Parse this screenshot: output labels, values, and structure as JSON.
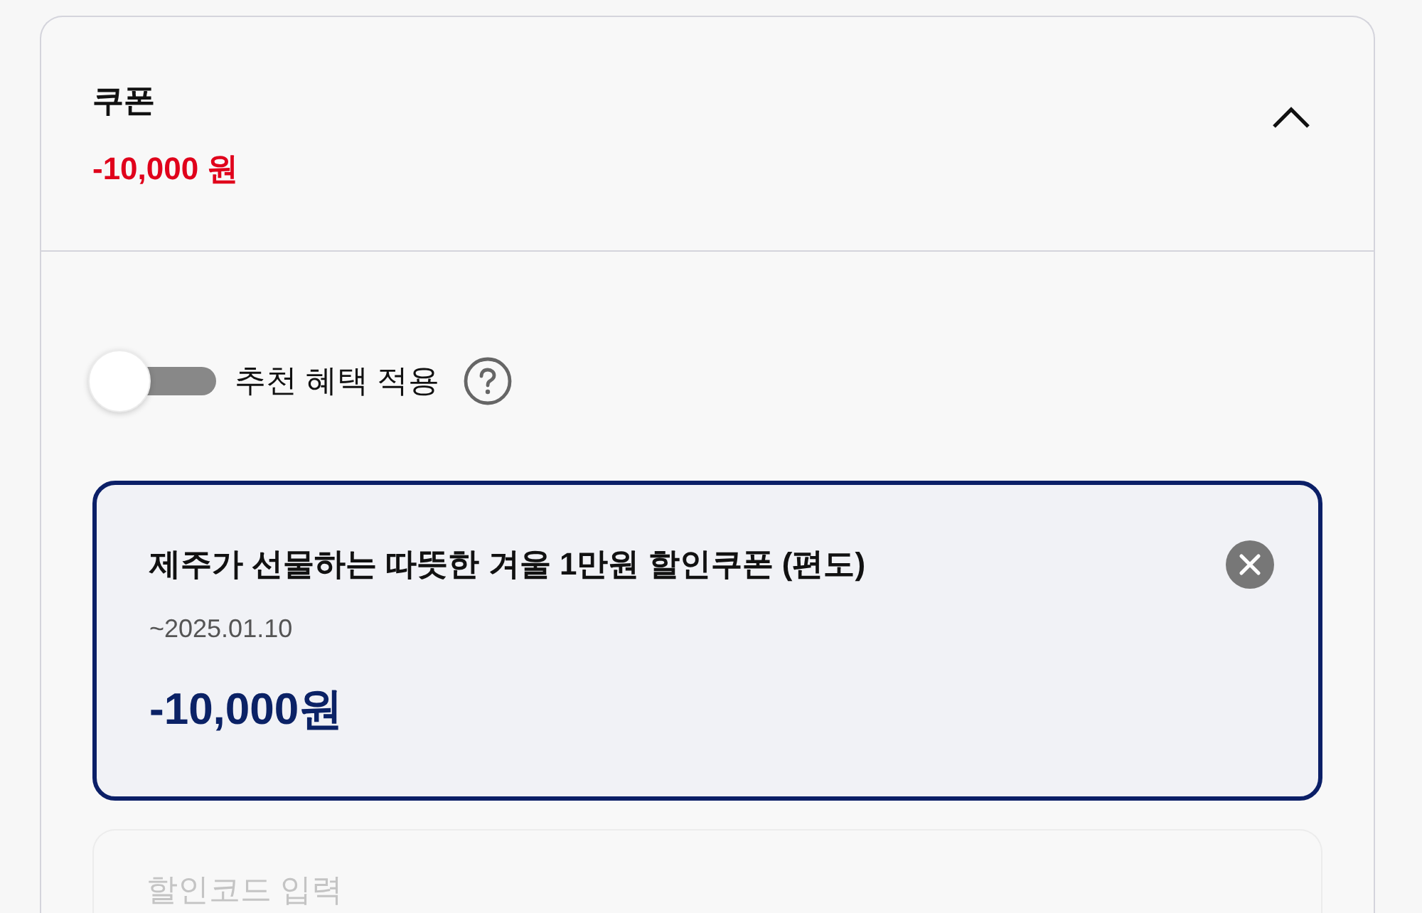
{
  "section": {
    "title": "쿠폰",
    "total": "-10,000 원",
    "expanded": true
  },
  "recommend_toggle": {
    "label": "추천 혜택 적용",
    "on": false
  },
  "applied_coupons": [
    {
      "name": "제주가 선물하는 따뜻한 겨울 1만원 할인쿠폰 (편도)",
      "expiry": "~2025.01.10",
      "amount": "-10,000원",
      "selected": true
    }
  ],
  "code_input": {
    "placeholder": "할인코드 입력"
  }
}
